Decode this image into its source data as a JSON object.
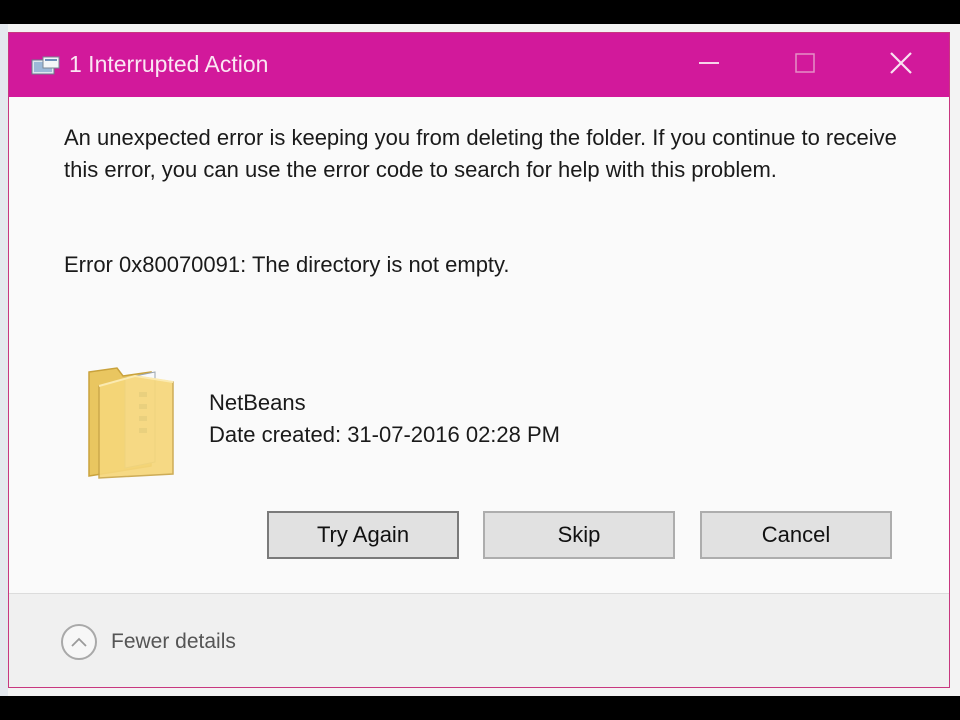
{
  "window": {
    "title": "1 Interrupted Action",
    "accent_color": "#d2199b",
    "controls": {
      "minimize_icon": "minimize-icon",
      "maximize_icon": "maximize-icon",
      "close_icon": "close-icon"
    }
  },
  "dialog": {
    "message": "An unexpected error is keeping you from deleting the folder. If you continue to receive this error, you can use the error code to search for help with this problem.",
    "error": "Error 0x80070091: The directory is not empty.",
    "item": {
      "icon": "folder-icon",
      "name": "NetBeans",
      "date_created": "Date created: 31-07-2016 02:28 PM"
    },
    "buttons": {
      "try_again": "Try Again",
      "skip": "Skip",
      "cancel": "Cancel"
    }
  },
  "footer": {
    "toggle_icon": "chevron-up-icon",
    "toggle_label": "Fewer details"
  }
}
